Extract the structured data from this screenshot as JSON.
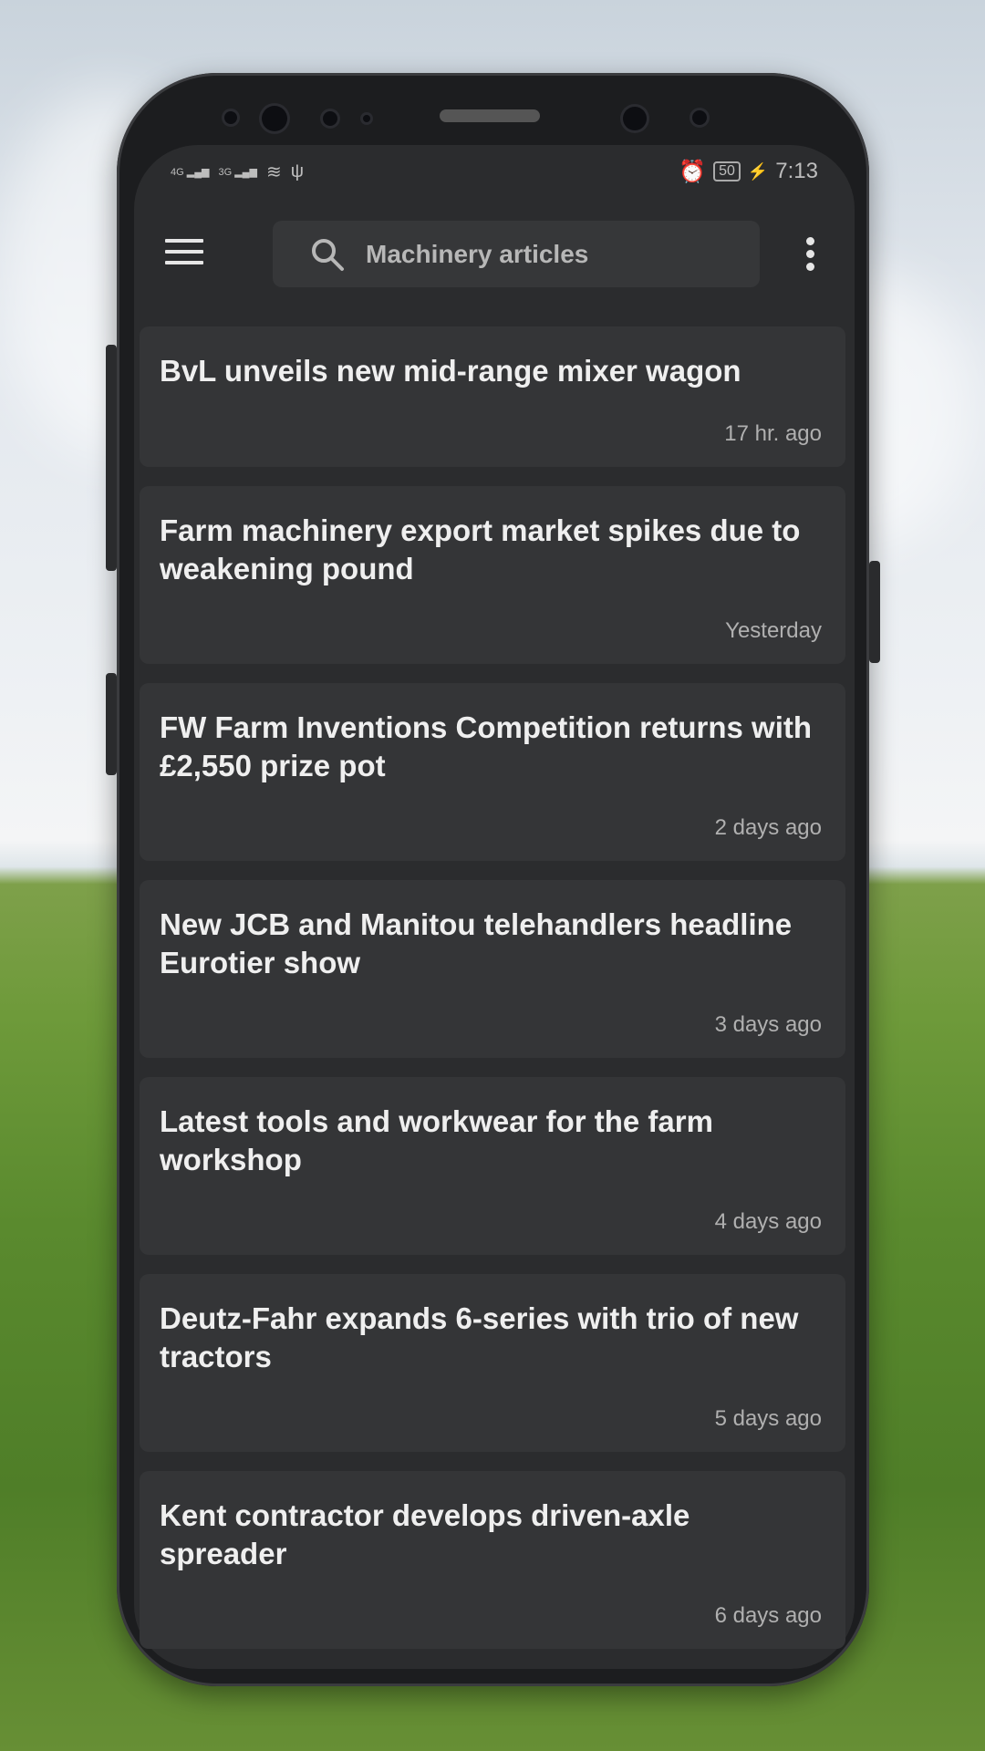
{
  "status_bar": {
    "network1": "4G",
    "network2": "3G",
    "battery": "50",
    "time": "7:13"
  },
  "toolbar": {
    "search_placeholder": "Machinery articles"
  },
  "articles": [
    {
      "title": "BvL unveils new mid-range mixer wagon",
      "time": "17 hr. ago"
    },
    {
      "title": "Farm machinery export market spikes due to weakening pound",
      "time": "Yesterday"
    },
    {
      "title": "FW Farm Inventions Competition returns with £2,550 prize pot",
      "time": "2 days ago"
    },
    {
      "title": "New JCB and Manitou telehandlers headline Eurotier show",
      "time": "3 days ago"
    },
    {
      "title": "Latest tools and workwear for the farm workshop",
      "time": "4 days ago"
    },
    {
      "title": "Deutz-Fahr expands 6-series with trio of new tractors",
      "time": "5 days ago"
    },
    {
      "title": "Kent contractor develops driven-axle spreader",
      "time": "6 days ago"
    }
  ]
}
